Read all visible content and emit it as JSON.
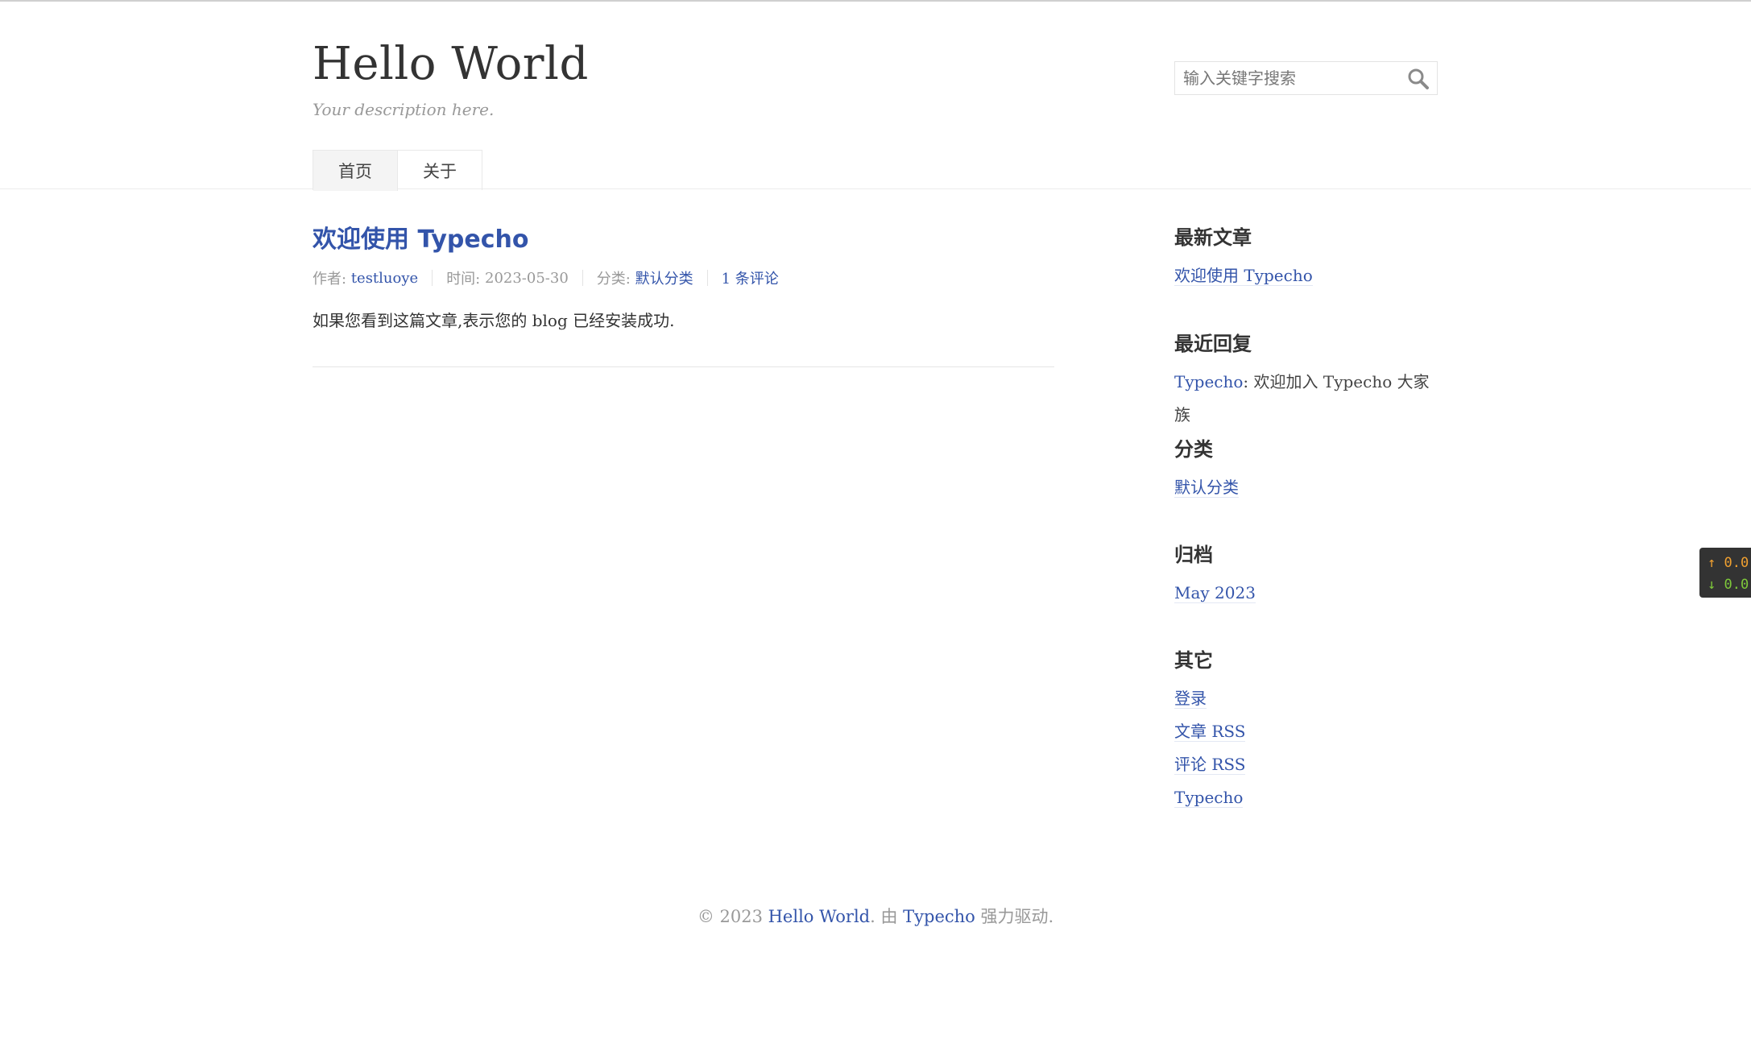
{
  "site": {
    "title": "Hello World",
    "description": "Your description here."
  },
  "search": {
    "placeholder": "输入关键字搜索",
    "value": ""
  },
  "nav": [
    {
      "label": "首页",
      "active": true
    },
    {
      "label": "关于",
      "active": false
    }
  ],
  "post": {
    "title": "欢迎使用 Typecho",
    "author_label": "作者:",
    "author": "testluoye",
    "date_label": "时间:",
    "date": "2023-05-30",
    "category_label": "分类:",
    "category": "默认分类",
    "comments": "1 条评论",
    "content": "如果您看到这篇文章,表示您的 blog 已经安装成功."
  },
  "sidebar": {
    "recent_posts": {
      "title": "最新文章",
      "items": [
        "欢迎使用 Typecho"
      ]
    },
    "recent_comments": {
      "title": "最近回复",
      "author": "Typecho",
      "text": ": 欢迎加入 Typecho 大家族"
    },
    "categories": {
      "title": "分类",
      "items": [
        "默认分类"
      ]
    },
    "archives": {
      "title": "归档",
      "items": [
        "May 2023"
      ]
    },
    "misc": {
      "title": "其它",
      "items": [
        "登录",
        "文章 RSS",
        "评论 RSS",
        "Typecho"
      ]
    }
  },
  "footer": {
    "copyright": "© 2023 ",
    "site_link": "Hello World",
    "middle": ". 由 ",
    "powered_link": "Typecho",
    "end": " 强力驱动."
  },
  "netspeed": {
    "up": "0.0",
    "down": "0.0",
    "up_color": "#f0a030",
    "down_color": "#7ec83a"
  },
  "colors": {
    "link": "#3354AA",
    "text": "#444444",
    "muted": "#999999"
  }
}
